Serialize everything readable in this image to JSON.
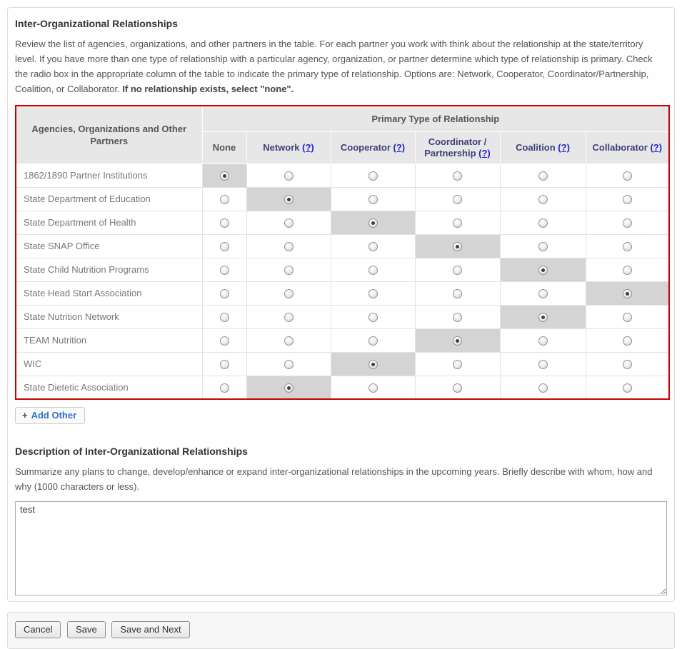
{
  "page": {
    "title": "Inter-Organizational Relationships",
    "intro_text": "Review the list of agencies, organizations, and other partners in the table. For each partner you work with think about the relationship at the state/territory level. If you have more than one type of relationship with a particular agency, organization, or partner determine which type of relationship is primary. Check the radio box in the appropriate column of the table to indicate the primary type of relationship. Options are: Network, Cooperator, Coordinator/Partnership, Coalition, or Collaborator. ",
    "intro_bold": "If no relationship exists, select \"none\"."
  },
  "table": {
    "corner_header": "Agencies, Organizations and Other Partners",
    "group_header": "Primary Type of Relationship",
    "help_symbol": "(?)",
    "columns": [
      {
        "label": "None",
        "has_help": false
      },
      {
        "label": "Network",
        "has_help": true
      },
      {
        "label": "Cooperator",
        "has_help": true
      },
      {
        "label": "Coordinator / Partnership",
        "has_help": true
      },
      {
        "label": "Coalition",
        "has_help": true
      },
      {
        "label": "Collaborator",
        "has_help": true
      }
    ],
    "rows": [
      {
        "partner": "1862/1890 Partner Institutions",
        "selected": 0
      },
      {
        "partner": "State Department of Education",
        "selected": 1
      },
      {
        "partner": "State Department of Health",
        "selected": 2
      },
      {
        "partner": "State SNAP Office",
        "selected": 3
      },
      {
        "partner": "State Child Nutrition Programs",
        "selected": 4
      },
      {
        "partner": "State Head Start Association",
        "selected": 5
      },
      {
        "partner": "State Nutrition Network",
        "selected": 4
      },
      {
        "partner": "TEAM Nutrition",
        "selected": 3
      },
      {
        "partner": "WIC",
        "selected": 2
      },
      {
        "partner": "State Dietetic Association",
        "selected": 1
      }
    ]
  },
  "add_other": {
    "plus": "+",
    "label": "Add Other"
  },
  "description": {
    "title": "Description of Inter-Organizational Relationships",
    "instructions": "Summarize any plans to change, develop/enhance or expand inter-organizational relationships in the upcoming years. Briefly describe with whom, how and why (1000 characters or less).",
    "value": "test"
  },
  "footer": {
    "cancel_label": "Cancel",
    "save_label": "Save",
    "save_next_label": "Save and Next"
  },
  "colors": {
    "table_border": "#cb0101",
    "selected_cell": "#d4d4d4",
    "help_link_blue": "#2323cd",
    "option_label_navy": "#3e3e7c",
    "add_other_blue": "#3072c4"
  }
}
